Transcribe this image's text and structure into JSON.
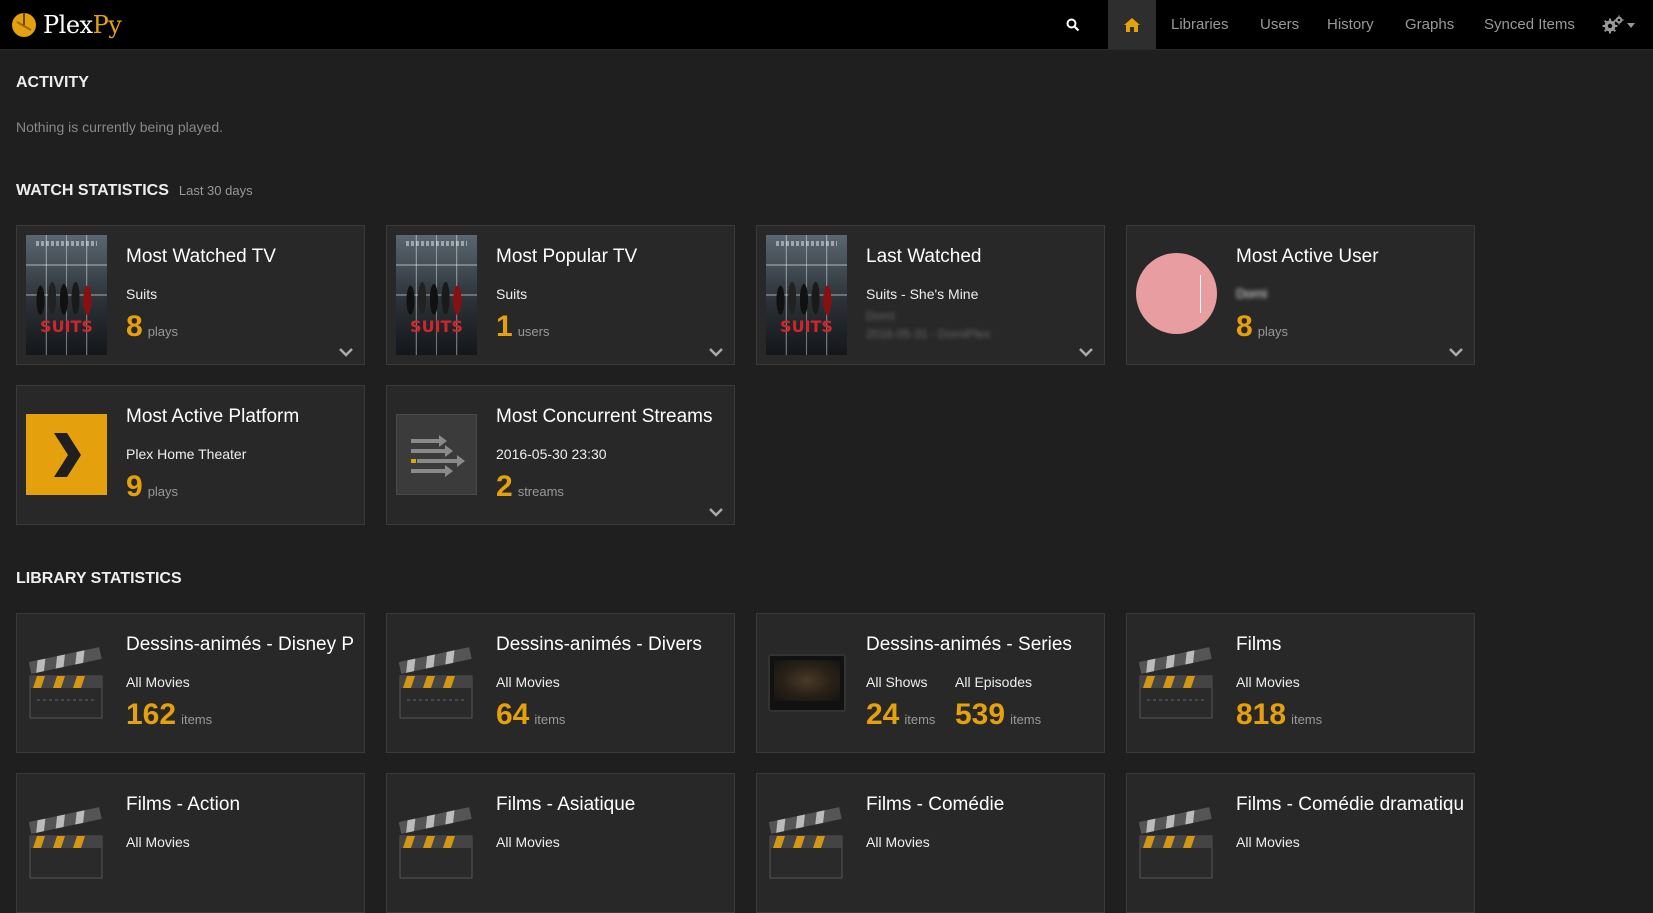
{
  "navbar": {
    "brand_plex": "Plex",
    "brand_py": "Py",
    "search_icon": "search-icon",
    "home_icon": "home-icon",
    "links": [
      "Libraries",
      "Users",
      "History",
      "Graphs",
      "Synced Items"
    ],
    "settings_icon": "gears-icon",
    "accent": "#e5a00d"
  },
  "activity": {
    "title": "ACTIVITY",
    "empty": "Nothing is currently being played."
  },
  "watch_stats": {
    "title": "WATCH STATISTICS",
    "subtitle": "Last 30 days",
    "cards": [
      {
        "title": "Most Watched TV",
        "sub": "Suits",
        "value": "8",
        "unit": "plays",
        "poster": "SUITS"
      },
      {
        "title": "Most Popular TV",
        "sub": "Suits",
        "value": "1",
        "unit": "users",
        "poster": "SUITS"
      },
      {
        "title": "Last Watched",
        "sub": "Suits - She's Mine",
        "detail1": "Dorni",
        "detail2": "2016-05-31 - DorniPlex",
        "poster": "SUITS"
      },
      {
        "title": "Most Active User",
        "sub": "Dorni",
        "value": "8",
        "unit": "plays"
      },
      {
        "title": "Most Active Platform",
        "sub": "Plex Home Theater",
        "value": "9",
        "unit": "plays"
      },
      {
        "title": "Most Concurrent Streams",
        "sub": "2016-05-30 23:30",
        "value": "2",
        "unit": "streams"
      }
    ]
  },
  "library_stats": {
    "title": "LIBRARY STATISTICS",
    "cards": [
      {
        "title": "Dessins-animés - Disney Pixar",
        "sub": "All Movies",
        "value": "162",
        "unit": "items"
      },
      {
        "title": "Dessins-animés - Divers",
        "sub": "All Movies",
        "value": "64",
        "unit": "items"
      },
      {
        "title": "Dessins-animés - Series",
        "sub": "All Shows",
        "value": "24",
        "unit": "items",
        "sub2": "All Episodes",
        "value2": "539",
        "unit2": "items"
      },
      {
        "title": "Films",
        "sub": "All Movies",
        "value": "818",
        "unit": "items"
      },
      {
        "title": "Films - Action",
        "sub": "All Movies"
      },
      {
        "title": "Films - Asiatique",
        "sub": "All Movies"
      },
      {
        "title": "Films - Comédie",
        "sub": "All Movies"
      },
      {
        "title": "Films - Comédie dramatique",
        "sub": "All Movies"
      }
    ]
  }
}
